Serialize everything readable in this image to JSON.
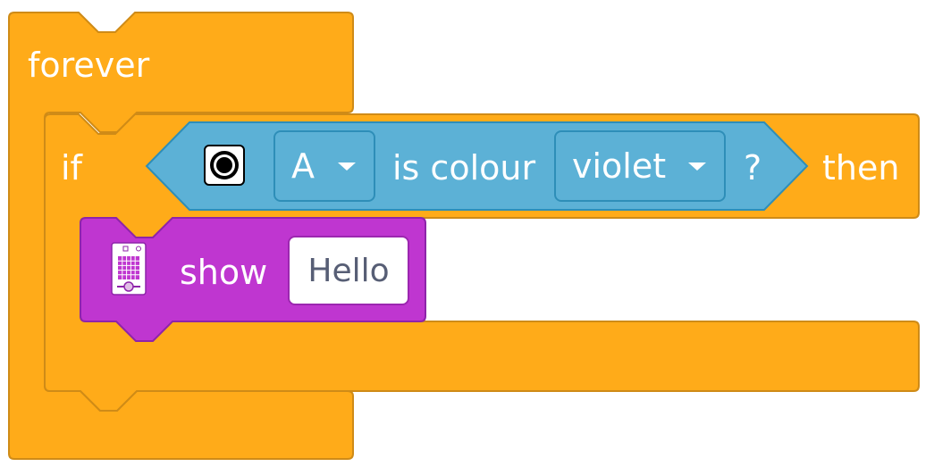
{
  "blocks": {
    "forever": {
      "label": "forever",
      "color": "#ffab19",
      "border": "#cf8b17"
    },
    "if_block": {
      "if_label": "if",
      "then_label": "then",
      "color": "#ffab19"
    },
    "condition": {
      "icon": "colour-sensor-icon",
      "port": {
        "value": "A"
      },
      "middle_label": "is colour",
      "colour": {
        "value": "violet"
      },
      "question_mark": "?",
      "color": "#5cb1d6",
      "border": "#2e8eb8"
    },
    "show": {
      "icon": "led-matrix-board-icon",
      "label": "show",
      "text": {
        "value": "Hello"
      },
      "color": "#bf36d0",
      "border": "#8e24aa"
    }
  }
}
